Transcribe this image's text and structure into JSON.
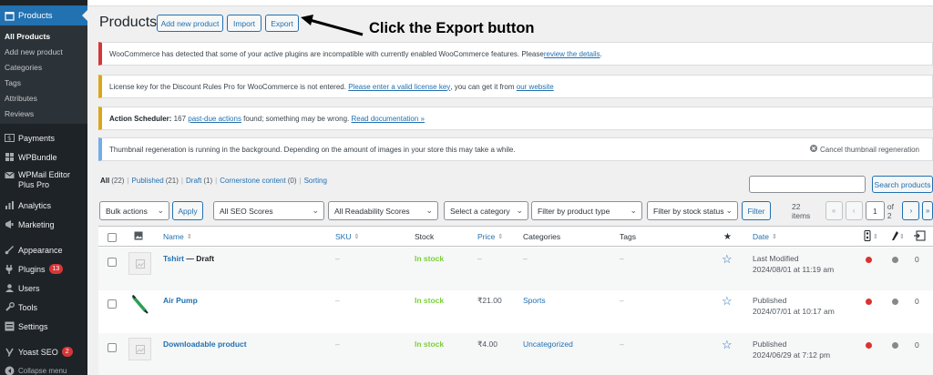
{
  "sidebar": {
    "active": "Products",
    "submenu": [
      "All Products",
      "Add new product",
      "Categories",
      "Tags",
      "Attributes",
      "Reviews"
    ],
    "items": [
      {
        "label": "Payments",
        "icon": "payments-icon"
      },
      {
        "label": "WPBundle",
        "icon": "grid-icon"
      },
      {
        "label": "WPMail Editor Plus Pro",
        "icon": "mail-icon"
      },
      {
        "label": "Analytics",
        "icon": "bar-chart-icon"
      },
      {
        "label": "Marketing",
        "icon": "megaphone-icon"
      },
      {
        "label": "Appearance",
        "icon": "brush-icon"
      },
      {
        "label": "Plugins",
        "icon": "plug-icon",
        "badge": "13"
      },
      {
        "label": "Users",
        "icon": "users-icon"
      },
      {
        "label": "Tools",
        "icon": "wrench-icon"
      },
      {
        "label": "Settings",
        "icon": "settings-icon"
      },
      {
        "label": "Yoast SEO",
        "icon": "yoast-icon",
        "badge": "2"
      },
      {
        "label": "Collapse menu",
        "icon": "collapse-icon"
      }
    ]
  },
  "header": {
    "title": "Products",
    "add_new": "Add new product",
    "import": "Import",
    "export": "Export",
    "instruction": "Click the Export button"
  },
  "notices": {
    "n1_text": "WooCommerce has detected that some of your active plugins are incompatible with currently enabled WooCommerce features. Please ",
    "n1_link": "review the details",
    "n1_end": ".",
    "n2_text": "License key for the Discount Rules Pro for WooCommerce is not entered. ",
    "n2_link": "Please enter a valid license key",
    "n2_mid": ", you can get it from ",
    "n2_link2": "our website",
    "n3_bold": "Action Scheduler:",
    "n3_text1": " 167 ",
    "n3_link": "past-due actions",
    "n3_text2": " found; something may be wrong. ",
    "n3_link2": "Read documentation »",
    "n4_text": "Thumbnail regeneration is running in the background. Depending on the amount of images in your store this may take a while.",
    "n4_dismiss": "Cancel thumbnail regeneration"
  },
  "views": {
    "all": "All",
    "all_count": "(22)",
    "published": "Published",
    "published_count": "(21)",
    "draft": "Draft",
    "draft_count": "(1)",
    "cornerstone": "Cornerstone content",
    "cornerstone_count": "(0)",
    "sorting": "Sorting",
    "sep": "|"
  },
  "search": {
    "button": "Search products",
    "value": ""
  },
  "filters": {
    "bulk": "Bulk actions",
    "apply": "Apply",
    "seo": "All SEO Scores",
    "readability": "All Readability Scores",
    "category": "Select a category",
    "product_type": "Filter by product type",
    "stock_status": "Filter by stock status",
    "filter_btn": "Filter"
  },
  "pagination": {
    "items": "22 items",
    "first": "«",
    "prev": "‹",
    "current": "1",
    "of": "of 2",
    "next": "›",
    "last": "»"
  },
  "table": {
    "headers": {
      "name": "Name",
      "sku": "SKU",
      "stock": "Stock",
      "price": "Price",
      "categories": "Categories",
      "tags": "Tags",
      "date": "Date"
    },
    "rows": [
      {
        "name": "Tshirt",
        "state": " — Draft",
        "sku": "–",
        "stock": "In stock",
        "price": "–",
        "categories": "–",
        "tags": "–",
        "date_status": "Last Modified",
        "date_value": "2024/08/01 at 11:19 am",
        "count": "0"
      },
      {
        "name": "Air Pump",
        "state": "",
        "sku": "–",
        "stock": "In stock",
        "price": "₹21.00",
        "categories": "Sports",
        "tags": "–",
        "date_status": "Published",
        "date_value": "2024/07/01 at 10:17 am",
        "count": "0"
      },
      {
        "name": "Downloadable product",
        "state": "",
        "sku": "–",
        "stock": "In stock",
        "price": "₹4.00",
        "categories": "Uncategorized",
        "tags": "–",
        "date_status": "Published",
        "date_value": "2024/06/29 at 7:12 pm",
        "count": "0"
      }
    ]
  },
  "colors": {
    "admin_bg": "#1d2327",
    "accent": "#2271b1",
    "error": "#d63638",
    "warning": "#dba617",
    "info": "#72aee6",
    "in_stock": "#7ad03a"
  }
}
